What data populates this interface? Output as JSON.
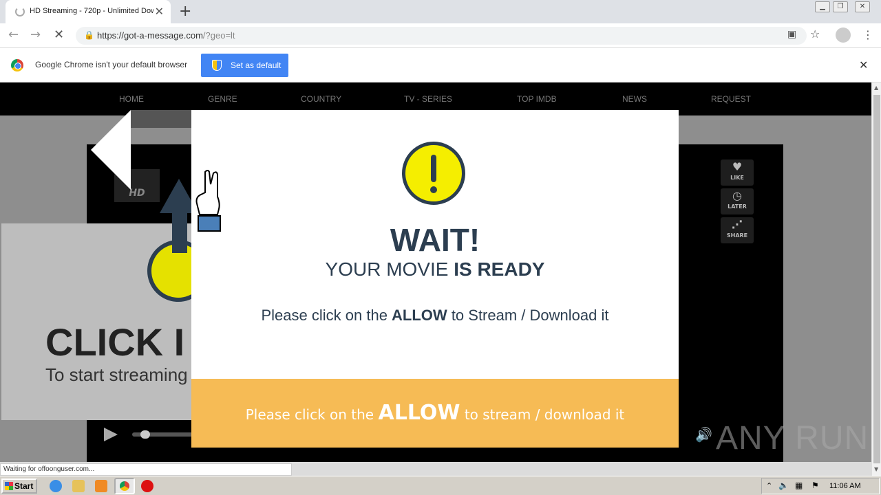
{
  "browser": {
    "tab_title": "HD Streaming - 720p - Unlimited Dow",
    "url_main": "https://got-a-message.com",
    "url_rest": "/?geo=lt"
  },
  "infobar": {
    "message": "Google Chrome isn't your default browser",
    "button_label": "Set as default"
  },
  "site_nav": {
    "items": [
      "HOME",
      "GENRE",
      "COUNTRY",
      "TV - SERIES",
      "TOP IMDB",
      "NEWS",
      "REQUEST"
    ]
  },
  "player": {
    "badge": "HD",
    "side_buttons": [
      {
        "label": "LIKE",
        "icon": "heart-icon"
      },
      {
        "label": "LATER",
        "icon": "clock-icon"
      },
      {
        "label": "SHARE",
        "icon": "share-icon"
      }
    ],
    "overlay_big": "CLICK I",
    "overlay_sub": "To start streaming"
  },
  "modal": {
    "title": "WAIT!",
    "subtitle_plain": "YOUR MOVIE ",
    "subtitle_bold": "IS READY",
    "msg_pre": "Please click on the ",
    "msg_bold": "ALLOW",
    "msg_post": " to Stream / Download it",
    "footer_pre": "Please click on the ",
    "footer_bold": "ALLOW",
    "footer_post": " to stream / download it",
    "footer_color": "#f6bb55",
    "text_color": "#2c3e50"
  },
  "watermark": "ANY RUN",
  "status_text": "Waiting for offoonguser.com...",
  "taskbar": {
    "start_label": "Start",
    "clock": "11:06 AM"
  }
}
